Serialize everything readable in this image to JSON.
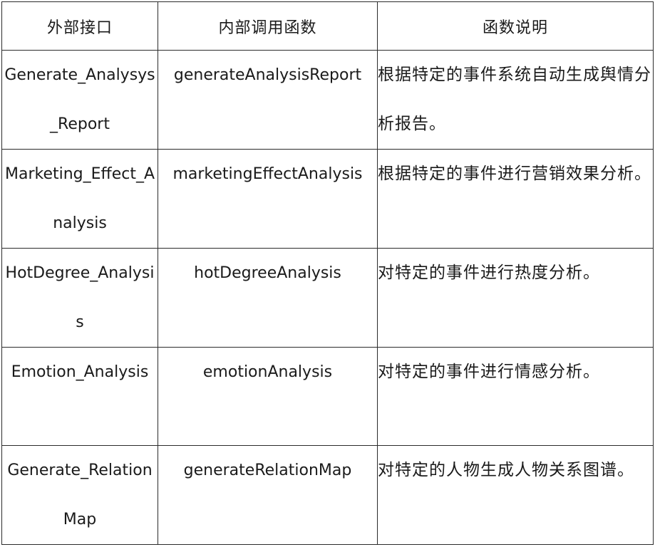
{
  "table": {
    "headers": {
      "external_interface": "外部接口",
      "internal_function": "内部调用函数",
      "description": "函数说明"
    },
    "rows": [
      {
        "external_interface": "Generate_Analysys_Report",
        "internal_function": "generateAnalysisReport",
        "description": "根据特定的事件系统自动生成舆情分析报告。"
      },
      {
        "external_interface": "Marketing_Effect_Analysis",
        "internal_function": "marketingEffectAnalysis",
        "description": "根据特定的事件进行营销效果分析。"
      },
      {
        "external_interface": "HotDegree_Analysis",
        "internal_function": "hotDegreeAnalysis",
        "description": "对特定的事件进行热度分析。"
      },
      {
        "external_interface": "Emotion_Analysis",
        "internal_function": "emotionAnalysis",
        "description": "对特定的事件进行情感分析。"
      },
      {
        "external_interface": "Generate_RelationMap",
        "internal_function": "generateRelationMap",
        "description": "对特定的人物生成人物关系图谱。"
      }
    ]
  }
}
